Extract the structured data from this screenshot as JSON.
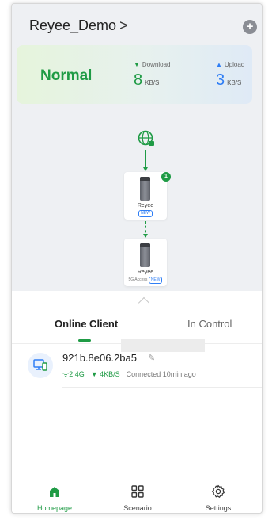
{
  "header": {
    "network_name": "Reyee_Demo",
    "chevron": ">",
    "add_symbol": "+"
  },
  "status": {
    "state": "Normal",
    "download": {
      "label": "Download",
      "value": "8",
      "unit": "KB/S"
    },
    "upload": {
      "label": "Upload",
      "value": "3",
      "unit": "KB/S"
    }
  },
  "topology": {
    "router": {
      "name": "Reyee",
      "tag": "NEW",
      "badge": "1"
    },
    "access_point": {
      "name": "Reyee",
      "sub_label": "5G Access",
      "tag": "NEW"
    }
  },
  "tabs": {
    "online_client": "Online Client",
    "in_control": "In Control"
  },
  "clients": [
    {
      "name": "921b.8e06.2ba5",
      "band": "2.4G",
      "speed": "4KB/S",
      "status": "Connected 10min ago"
    }
  ],
  "nav": {
    "home": "Homepage",
    "scenario": "Scenario",
    "settings": "Settings"
  },
  "colors": {
    "accent_green": "#1f9b45",
    "accent_blue": "#2f7ef5",
    "background_grey": "#eef0f3"
  }
}
